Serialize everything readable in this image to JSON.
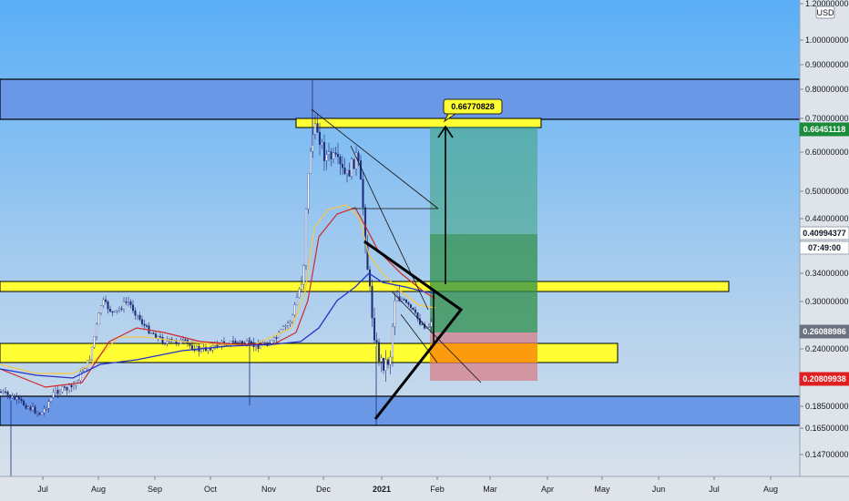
{
  "chart_data": {
    "type": "candlestick",
    "currency_label": "USD",
    "x_ticks": [
      {
        "label": "Jul",
        "bold": false
      },
      {
        "label": "Aug",
        "bold": false
      },
      {
        "label": "Sep",
        "bold": false
      },
      {
        "label": "Oct",
        "bold": false
      },
      {
        "label": "Nov",
        "bold": false
      },
      {
        "label": "Dec",
        "bold": false
      },
      {
        "label": "2021",
        "bold": true
      },
      {
        "label": "Feb",
        "bold": false
      },
      {
        "label": "Mar",
        "bold": false
      },
      {
        "label": "Apr",
        "bold": false
      },
      {
        "label": "May",
        "bold": false
      },
      {
        "label": "Jun",
        "bold": false
      },
      {
        "label": "Jul",
        "bold": false
      },
      {
        "label": "Aug",
        "bold": false
      }
    ],
    "y_ticks": [
      "1.20000000",
      "1.00000000",
      "0.90000000",
      "0.80000000",
      "0.70000000",
      "0.60000000",
      "0.50000000",
      "0.44000000",
      "0.34000000",
      "0.30000000",
      "0.24000000",
      "0.18500000",
      "0.16500000",
      "0.14700000"
    ],
    "price_tags": [
      {
        "name": "current-price",
        "label": "0.66451118",
        "color": "#1b8d3a"
      },
      {
        "name": "level-upper",
        "label": "0.40994377",
        "color": "#ffffff"
      },
      {
        "name": "countdown",
        "label": "07:49:00",
        "color": "#ffffff"
      },
      {
        "name": "level-lower",
        "label": "0.26088986",
        "color": "#6b7280"
      },
      {
        "name": "stop-loss",
        "label": "0.20809938",
        "color": "#e02020"
      }
    ],
    "annotations": [
      {
        "name": "target-callout",
        "label": "0.66770828"
      }
    ],
    "colors": {
      "bull_candle": "#ffffff",
      "bear_candle": "#1e2a78",
      "ma_fast": "#f5c842",
      "ma_mid": "#d02828",
      "ma_slow": "#2233cc",
      "support_zone_yellow": "#ffff33",
      "support_zone_blue": "#5b8de8",
      "profit_zone": "#2e8f57",
      "loss_zone": "#d9646a"
    }
  }
}
